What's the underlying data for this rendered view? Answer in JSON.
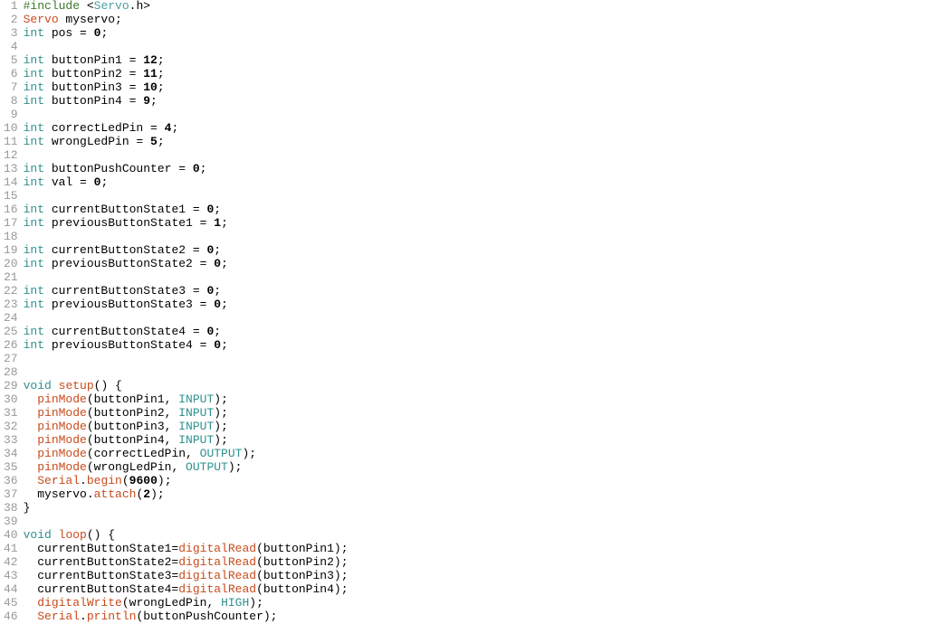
{
  "meta": {
    "language": "Arduino C++",
    "filename": "sketch.ino"
  },
  "chart_data": null,
  "code": {
    "lines": [
      {
        "num": "1",
        "tokens": [
          {
            "t": "#include ",
            "c": "tok-preproc"
          },
          {
            "t": "<",
            "c": "tok-ident"
          },
          {
            "t": "Servo",
            "c": "tok-header"
          },
          {
            "t": ".",
            "c": "tok-ident"
          },
          {
            "t": "h",
            "c": "tok-ident"
          },
          {
            "t": ">",
            "c": "tok-ident"
          }
        ]
      },
      {
        "num": "2",
        "tokens": [
          {
            "t": "Servo",
            "c": "tok-class"
          },
          {
            "t": " myservo;",
            "c": "tok-ident"
          }
        ]
      },
      {
        "num": "3",
        "tokens": [
          {
            "t": "int",
            "c": "tok-keyword"
          },
          {
            "t": " pos = ",
            "c": "tok-ident"
          },
          {
            "t": "0",
            "c": "tok-num"
          },
          {
            "t": ";",
            "c": "tok-ident"
          }
        ]
      },
      {
        "num": "4",
        "tokens": []
      },
      {
        "num": "5",
        "tokens": [
          {
            "t": "int",
            "c": "tok-keyword"
          },
          {
            "t": " buttonPin1 = ",
            "c": "tok-ident"
          },
          {
            "t": "12",
            "c": "tok-num"
          },
          {
            "t": ";",
            "c": "tok-ident"
          }
        ]
      },
      {
        "num": "6",
        "tokens": [
          {
            "t": "int",
            "c": "tok-keyword"
          },
          {
            "t": " buttonPin2 = ",
            "c": "tok-ident"
          },
          {
            "t": "11",
            "c": "tok-num"
          },
          {
            "t": ";",
            "c": "tok-ident"
          }
        ]
      },
      {
        "num": "7",
        "tokens": [
          {
            "t": "int",
            "c": "tok-keyword"
          },
          {
            "t": " buttonPin3 = ",
            "c": "tok-ident"
          },
          {
            "t": "10",
            "c": "tok-num"
          },
          {
            "t": ";",
            "c": "tok-ident"
          }
        ]
      },
      {
        "num": "8",
        "tokens": [
          {
            "t": "int",
            "c": "tok-keyword"
          },
          {
            "t": " buttonPin4 = ",
            "c": "tok-ident"
          },
          {
            "t": "9",
            "c": "tok-num"
          },
          {
            "t": ";",
            "c": "tok-ident"
          }
        ]
      },
      {
        "num": "9",
        "tokens": []
      },
      {
        "num": "10",
        "tokens": [
          {
            "t": "int",
            "c": "tok-keyword"
          },
          {
            "t": " correctLedPin = ",
            "c": "tok-ident"
          },
          {
            "t": "4",
            "c": "tok-num"
          },
          {
            "t": ";",
            "c": "tok-ident"
          }
        ]
      },
      {
        "num": "11",
        "tokens": [
          {
            "t": "int",
            "c": "tok-keyword"
          },
          {
            "t": " wrongLedPin = ",
            "c": "tok-ident"
          },
          {
            "t": "5",
            "c": "tok-num"
          },
          {
            "t": ";",
            "c": "tok-ident"
          }
        ]
      },
      {
        "num": "12",
        "tokens": []
      },
      {
        "num": "13",
        "tokens": [
          {
            "t": "int",
            "c": "tok-keyword"
          },
          {
            "t": " buttonPushCounter = ",
            "c": "tok-ident"
          },
          {
            "t": "0",
            "c": "tok-num"
          },
          {
            "t": ";",
            "c": "tok-ident"
          }
        ]
      },
      {
        "num": "14",
        "tokens": [
          {
            "t": "int",
            "c": "tok-keyword"
          },
          {
            "t": " val = ",
            "c": "tok-ident"
          },
          {
            "t": "0",
            "c": "tok-num"
          },
          {
            "t": ";",
            "c": "tok-ident"
          }
        ]
      },
      {
        "num": "15",
        "tokens": []
      },
      {
        "num": "16",
        "tokens": [
          {
            "t": "int",
            "c": "tok-keyword"
          },
          {
            "t": " currentButtonState1 = ",
            "c": "tok-ident"
          },
          {
            "t": "0",
            "c": "tok-num"
          },
          {
            "t": ";",
            "c": "tok-ident"
          }
        ]
      },
      {
        "num": "17",
        "tokens": [
          {
            "t": "int",
            "c": "tok-keyword"
          },
          {
            "t": " previousButtonState1 = ",
            "c": "tok-ident"
          },
          {
            "t": "1",
            "c": "tok-num"
          },
          {
            "t": ";",
            "c": "tok-ident"
          }
        ]
      },
      {
        "num": "18",
        "tokens": []
      },
      {
        "num": "19",
        "tokens": [
          {
            "t": "int",
            "c": "tok-keyword"
          },
          {
            "t": " currentButtonState2 = ",
            "c": "tok-ident"
          },
          {
            "t": "0",
            "c": "tok-num"
          },
          {
            "t": ";",
            "c": "tok-ident"
          }
        ]
      },
      {
        "num": "20",
        "tokens": [
          {
            "t": "int",
            "c": "tok-keyword"
          },
          {
            "t": " previousButtonState2 = ",
            "c": "tok-ident"
          },
          {
            "t": "0",
            "c": "tok-num"
          },
          {
            "t": ";",
            "c": "tok-ident"
          }
        ]
      },
      {
        "num": "21",
        "tokens": []
      },
      {
        "num": "22",
        "tokens": [
          {
            "t": "int",
            "c": "tok-keyword"
          },
          {
            "t": " currentButtonState3 = ",
            "c": "tok-ident"
          },
          {
            "t": "0",
            "c": "tok-num"
          },
          {
            "t": ";",
            "c": "tok-ident"
          }
        ]
      },
      {
        "num": "23",
        "tokens": [
          {
            "t": "int",
            "c": "tok-keyword"
          },
          {
            "t": " previousButtonState3 = ",
            "c": "tok-ident"
          },
          {
            "t": "0",
            "c": "tok-num"
          },
          {
            "t": ";",
            "c": "tok-ident"
          }
        ]
      },
      {
        "num": "24",
        "tokens": []
      },
      {
        "num": "25",
        "tokens": [
          {
            "t": "int",
            "c": "tok-keyword"
          },
          {
            "t": " currentButtonState4 = ",
            "c": "tok-ident"
          },
          {
            "t": "0",
            "c": "tok-num"
          },
          {
            "t": ";",
            "c": "tok-ident"
          }
        ]
      },
      {
        "num": "26",
        "tokens": [
          {
            "t": "int",
            "c": "tok-keyword"
          },
          {
            "t": " previousButtonState4 = ",
            "c": "tok-ident"
          },
          {
            "t": "0",
            "c": "tok-num"
          },
          {
            "t": ";",
            "c": "tok-ident"
          }
        ]
      },
      {
        "num": "27",
        "tokens": []
      },
      {
        "num": "28",
        "tokens": []
      },
      {
        "num": "29",
        "tokens": [
          {
            "t": "void",
            "c": "tok-keyword"
          },
          {
            "t": " ",
            "c": ""
          },
          {
            "t": "setup",
            "c": "tok-func"
          },
          {
            "t": "() {",
            "c": "tok-ident"
          }
        ]
      },
      {
        "num": "30",
        "tokens": [
          {
            "t": "  ",
            "c": ""
          },
          {
            "t": "pinMode",
            "c": "tok-call"
          },
          {
            "t": "(buttonPin1, ",
            "c": "tok-ident"
          },
          {
            "t": "INPUT",
            "c": "tok-const"
          },
          {
            "t": ");",
            "c": "tok-ident"
          }
        ]
      },
      {
        "num": "31",
        "tokens": [
          {
            "t": "  ",
            "c": ""
          },
          {
            "t": "pinMode",
            "c": "tok-call"
          },
          {
            "t": "(buttonPin2, ",
            "c": "tok-ident"
          },
          {
            "t": "INPUT",
            "c": "tok-const"
          },
          {
            "t": ");",
            "c": "tok-ident"
          }
        ]
      },
      {
        "num": "32",
        "tokens": [
          {
            "t": "  ",
            "c": ""
          },
          {
            "t": "pinMode",
            "c": "tok-call"
          },
          {
            "t": "(buttonPin3, ",
            "c": "tok-ident"
          },
          {
            "t": "INPUT",
            "c": "tok-const"
          },
          {
            "t": ");",
            "c": "tok-ident"
          }
        ]
      },
      {
        "num": "33",
        "tokens": [
          {
            "t": "  ",
            "c": ""
          },
          {
            "t": "pinMode",
            "c": "tok-call"
          },
          {
            "t": "(buttonPin4, ",
            "c": "tok-ident"
          },
          {
            "t": "INPUT",
            "c": "tok-const"
          },
          {
            "t": ");",
            "c": "tok-ident"
          }
        ]
      },
      {
        "num": "34",
        "tokens": [
          {
            "t": "  ",
            "c": ""
          },
          {
            "t": "pinMode",
            "c": "tok-call"
          },
          {
            "t": "(correctLedPin, ",
            "c": "tok-ident"
          },
          {
            "t": "OUTPUT",
            "c": "tok-const"
          },
          {
            "t": ");",
            "c": "tok-ident"
          }
        ]
      },
      {
        "num": "35",
        "tokens": [
          {
            "t": "  ",
            "c": ""
          },
          {
            "t": "pinMode",
            "c": "tok-call"
          },
          {
            "t": "(wrongLedPin, ",
            "c": "tok-ident"
          },
          {
            "t": "OUTPUT",
            "c": "tok-const"
          },
          {
            "t": ");",
            "c": "tok-ident"
          }
        ]
      },
      {
        "num": "36",
        "tokens": [
          {
            "t": "  ",
            "c": ""
          },
          {
            "t": "Serial",
            "c": "tok-class"
          },
          {
            "t": ".",
            "c": "tok-ident"
          },
          {
            "t": "begin",
            "c": "tok-call"
          },
          {
            "t": "(",
            "c": "tok-ident"
          },
          {
            "t": "9600",
            "c": "tok-num"
          },
          {
            "t": ");",
            "c": "tok-ident"
          }
        ]
      },
      {
        "num": "37",
        "tokens": [
          {
            "t": "  myservo.",
            "c": "tok-ident"
          },
          {
            "t": "attach",
            "c": "tok-call"
          },
          {
            "t": "(",
            "c": "tok-ident"
          },
          {
            "t": "2",
            "c": "tok-num"
          },
          {
            "t": ");",
            "c": "tok-ident"
          }
        ]
      },
      {
        "num": "38",
        "tokens": [
          {
            "t": "}",
            "c": "tok-ident"
          }
        ]
      },
      {
        "num": "39",
        "tokens": []
      },
      {
        "num": "40",
        "tokens": [
          {
            "t": "void",
            "c": "tok-keyword"
          },
          {
            "t": " ",
            "c": ""
          },
          {
            "t": "loop",
            "c": "tok-func"
          },
          {
            "t": "() {",
            "c": "tok-ident"
          }
        ]
      },
      {
        "num": "41",
        "tokens": [
          {
            "t": "  currentButtonState1=",
            "c": "tok-ident"
          },
          {
            "t": "digitalRead",
            "c": "tok-call"
          },
          {
            "t": "(buttonPin1);",
            "c": "tok-ident"
          }
        ]
      },
      {
        "num": "42",
        "tokens": [
          {
            "t": "  currentButtonState2=",
            "c": "tok-ident"
          },
          {
            "t": "digitalRead",
            "c": "tok-call"
          },
          {
            "t": "(buttonPin2);",
            "c": "tok-ident"
          }
        ]
      },
      {
        "num": "43",
        "tokens": [
          {
            "t": "  currentButtonState3=",
            "c": "tok-ident"
          },
          {
            "t": "digitalRead",
            "c": "tok-call"
          },
          {
            "t": "(buttonPin3);",
            "c": "tok-ident"
          }
        ]
      },
      {
        "num": "44",
        "tokens": [
          {
            "t": "  currentButtonState4=",
            "c": "tok-ident"
          },
          {
            "t": "digitalRead",
            "c": "tok-call"
          },
          {
            "t": "(buttonPin4);",
            "c": "tok-ident"
          }
        ]
      },
      {
        "num": "45",
        "tokens": [
          {
            "t": "  ",
            "c": ""
          },
          {
            "t": "digitalWrite",
            "c": "tok-call"
          },
          {
            "t": "(wrongLedPin, ",
            "c": "tok-ident"
          },
          {
            "t": "HIGH",
            "c": "tok-const"
          },
          {
            "t": ");",
            "c": "tok-ident"
          }
        ]
      },
      {
        "num": "46",
        "tokens": [
          {
            "t": "  ",
            "c": ""
          },
          {
            "t": "Serial",
            "c": "tok-class"
          },
          {
            "t": ".",
            "c": "tok-ident"
          },
          {
            "t": "println",
            "c": "tok-call"
          },
          {
            "t": "(buttonPushCounter);",
            "c": "tok-ident"
          }
        ]
      }
    ]
  }
}
